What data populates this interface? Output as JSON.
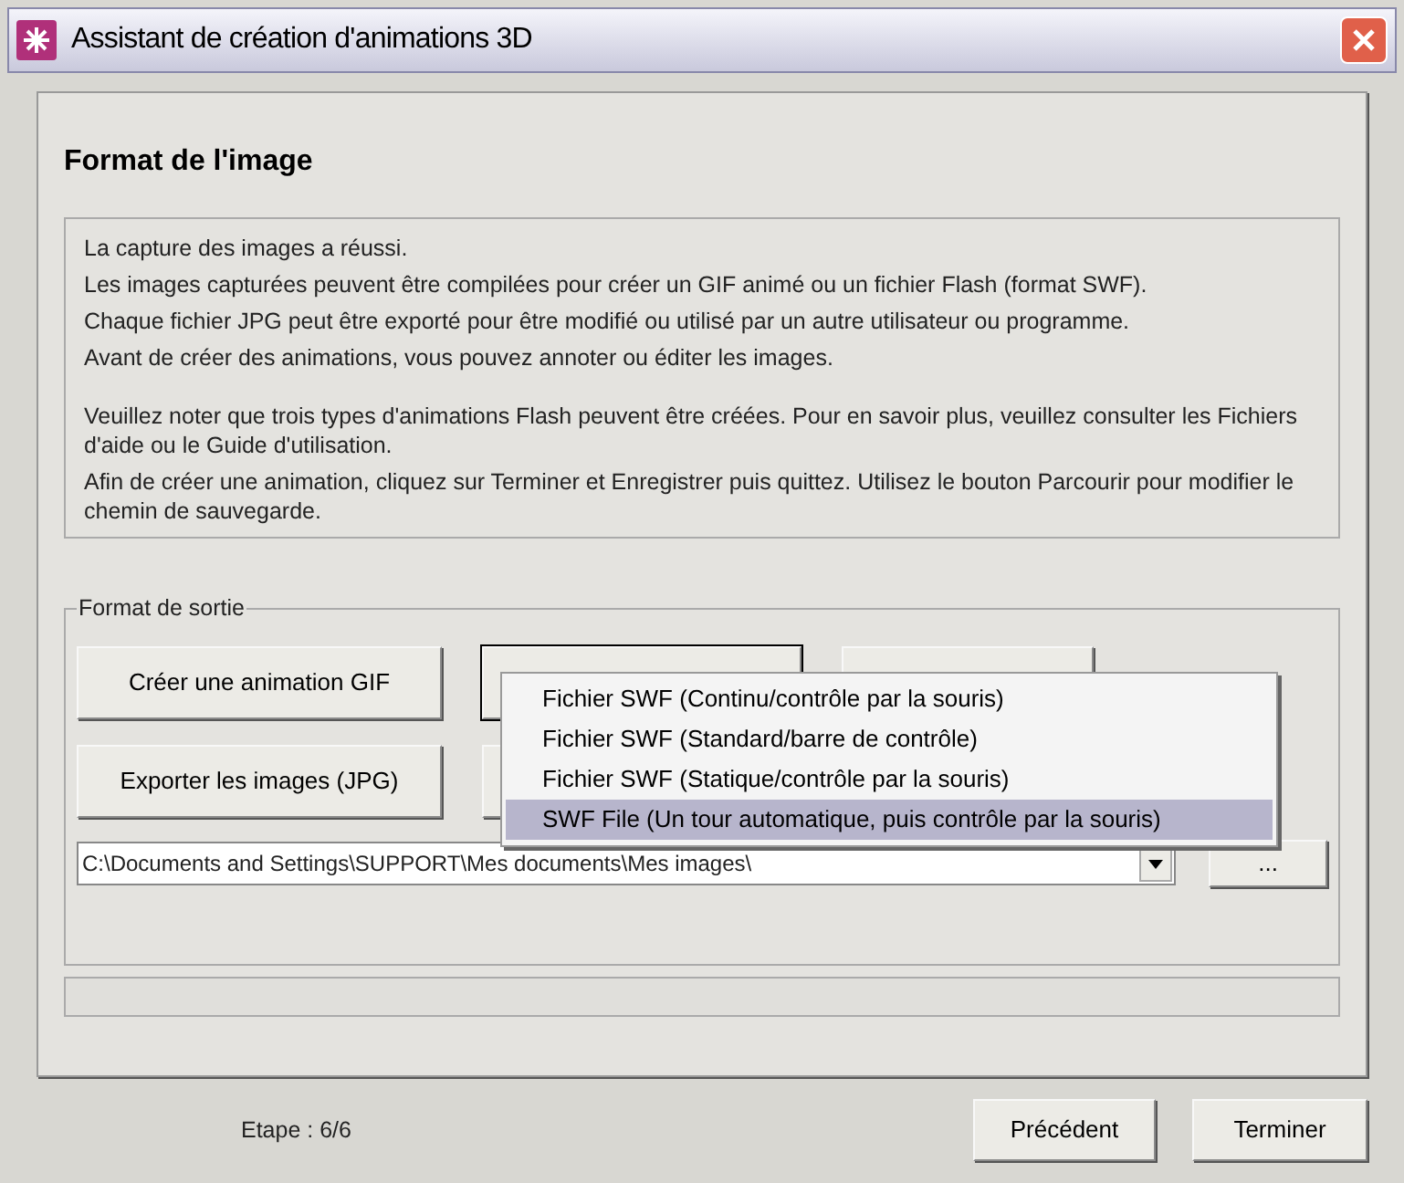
{
  "window": {
    "title": "Assistant de création d'animations 3D"
  },
  "header": "Format de l'image",
  "paragraphs": [
    [
      "La capture des images a réussi.",
      "Les images capturées peuvent être compilées pour créer un GIF animé ou un fichier Flash (format SWF).",
      "Chaque fichier JPG peut être exporté pour être modifié ou utilisé par un autre utilisateur ou programme.",
      "Avant de créer des animations, vous pouvez annoter ou éditer les images."
    ],
    [
      "Veuillez noter que trois types d'animations Flash peuvent être créées. Pour en savoir plus, veuillez consulter les Fichiers d'aide ou le Guide d'utilisation.",
      "Afin de créer une animation, cliquez sur Terminer et Enregistrer puis quittez. Utilisez le bouton Parcourir pour modifier le chemin de sauvegarde."
    ]
  ],
  "output_group": {
    "label": "Format de sortie",
    "buttons": [
      "Créer une animation GIF",
      "Exporter les images (JPG)"
    ],
    "menu": [
      {
        "label": "Fichier SWF (Continu/contrôle par la souris)",
        "selected": false
      },
      {
        "label": "Fichier SWF (Standard/barre de contrôle)",
        "selected": false
      },
      {
        "label": "Fichier SWF (Statique/contrôle par la souris)",
        "selected": false
      },
      {
        "label": "SWF File (Un tour automatique, puis contrôle par la souris)",
        "selected": true
      }
    ],
    "path": "C:\\Documents and Settings\\SUPPORT\\Mes documents\\Mes images\\",
    "browse": "..."
  },
  "progress": {
    "level": 0
  },
  "step": "Etape : 6/6",
  "nav_buttons": [
    "Précédent",
    "Terminer"
  ]
}
